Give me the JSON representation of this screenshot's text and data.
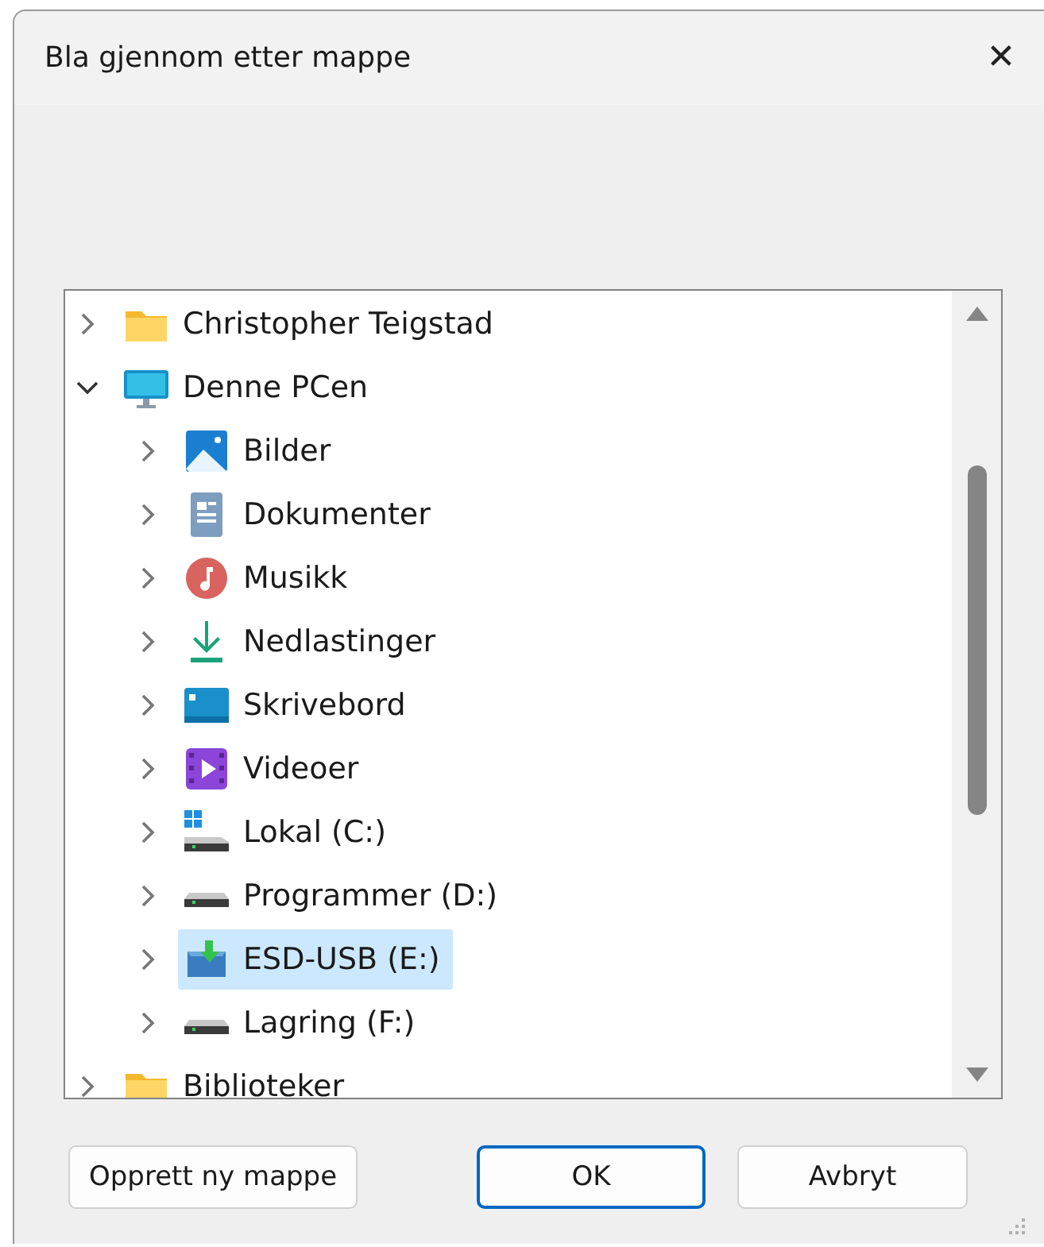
{
  "window": {
    "title": "Bla gjennom etter mappe",
    "close": "✕"
  },
  "tree": [
    {
      "label": "Christopher Teigstad",
      "kind": "folder",
      "expanded": false,
      "selected": false
    },
    {
      "label": "Denne PCen",
      "kind": "pc",
      "expanded": true,
      "selected": false,
      "children": [
        {
          "label": "Bilder",
          "kind": "pictures",
          "expanded": false,
          "selected": false
        },
        {
          "label": "Dokumenter",
          "kind": "documents",
          "expanded": false,
          "selected": false
        },
        {
          "label": "Musikk",
          "kind": "music",
          "expanded": false,
          "selected": false
        },
        {
          "label": "Nedlastinger",
          "kind": "downloads",
          "expanded": false,
          "selected": false
        },
        {
          "label": "Skrivebord",
          "kind": "desktop",
          "expanded": false,
          "selected": false
        },
        {
          "label": "Videoer",
          "kind": "videos",
          "expanded": false,
          "selected": false
        },
        {
          "label": "Lokal (C:)",
          "kind": "system-drive",
          "expanded": false,
          "selected": false
        },
        {
          "label": "Programmer (D:)",
          "kind": "drive",
          "expanded": false,
          "selected": false
        },
        {
          "label": "ESD-USB (E:)",
          "kind": "usb-drive",
          "expanded": false,
          "selected": true
        },
        {
          "label": "Lagring (F:)",
          "kind": "drive",
          "expanded": false,
          "selected": false
        }
      ]
    },
    {
      "label": "Biblioteker",
      "kind": "folder",
      "expanded": false,
      "selected": false
    }
  ],
  "buttons": [
    {
      "label": "Opprett ny mappe",
      "kind": "secondary"
    },
    {
      "label": "OK",
      "kind": "default"
    },
    {
      "label": "Avbryt",
      "kind": "secondary"
    }
  ]
}
